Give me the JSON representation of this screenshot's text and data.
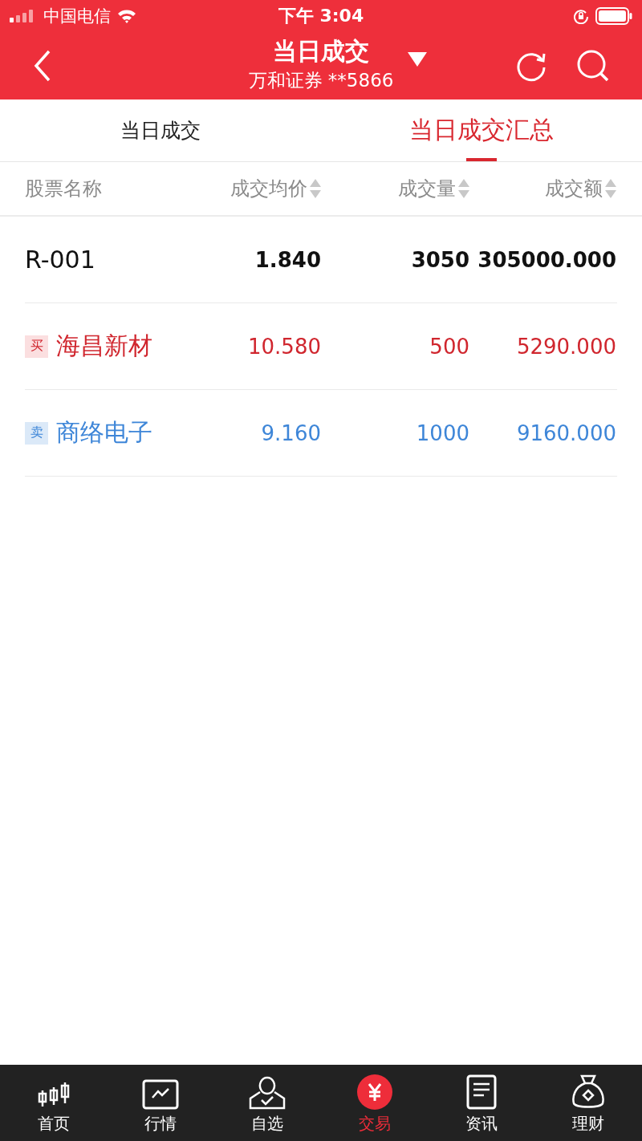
{
  "status_bar": {
    "carrier": "中国电信",
    "time": "下午 3:04"
  },
  "header": {
    "title": "当日成交",
    "subtitle": "万和证券 **5866"
  },
  "tabs": [
    {
      "label": "当日成交",
      "selected": false
    },
    {
      "label": "当日成交汇总",
      "selected": true
    }
  ],
  "table": {
    "columns": [
      {
        "label": "股票名称",
        "sortable": false
      },
      {
        "label": "成交均价",
        "sortable": true
      },
      {
        "label": "成交量",
        "sortable": true
      },
      {
        "label": "成交额",
        "sortable": true
      }
    ],
    "rows": [
      {
        "kind": "plain",
        "name": "R-001",
        "price": "1.840",
        "volume": "3050",
        "amount": "305000.000"
      },
      {
        "kind": "buy",
        "badge": "买",
        "name": "海昌新材",
        "price": "10.580",
        "volume": "500",
        "amount": "5290.000"
      },
      {
        "kind": "sell",
        "badge": "卖",
        "name": "商络电子",
        "price": "9.160",
        "volume": "1000",
        "amount": "9160.000"
      }
    ]
  },
  "bottom_nav": [
    {
      "kind": "candles",
      "label": "首页",
      "selected": false
    },
    {
      "kind": "chart",
      "label": "行情",
      "selected": false
    },
    {
      "kind": "person",
      "label": "自选",
      "selected": false
    },
    {
      "kind": "yen",
      "label": "交易",
      "selected": true
    },
    {
      "kind": "doc",
      "label": "资讯",
      "selected": false
    },
    {
      "kind": "bag",
      "label": "理财",
      "selected": false
    }
  ]
}
